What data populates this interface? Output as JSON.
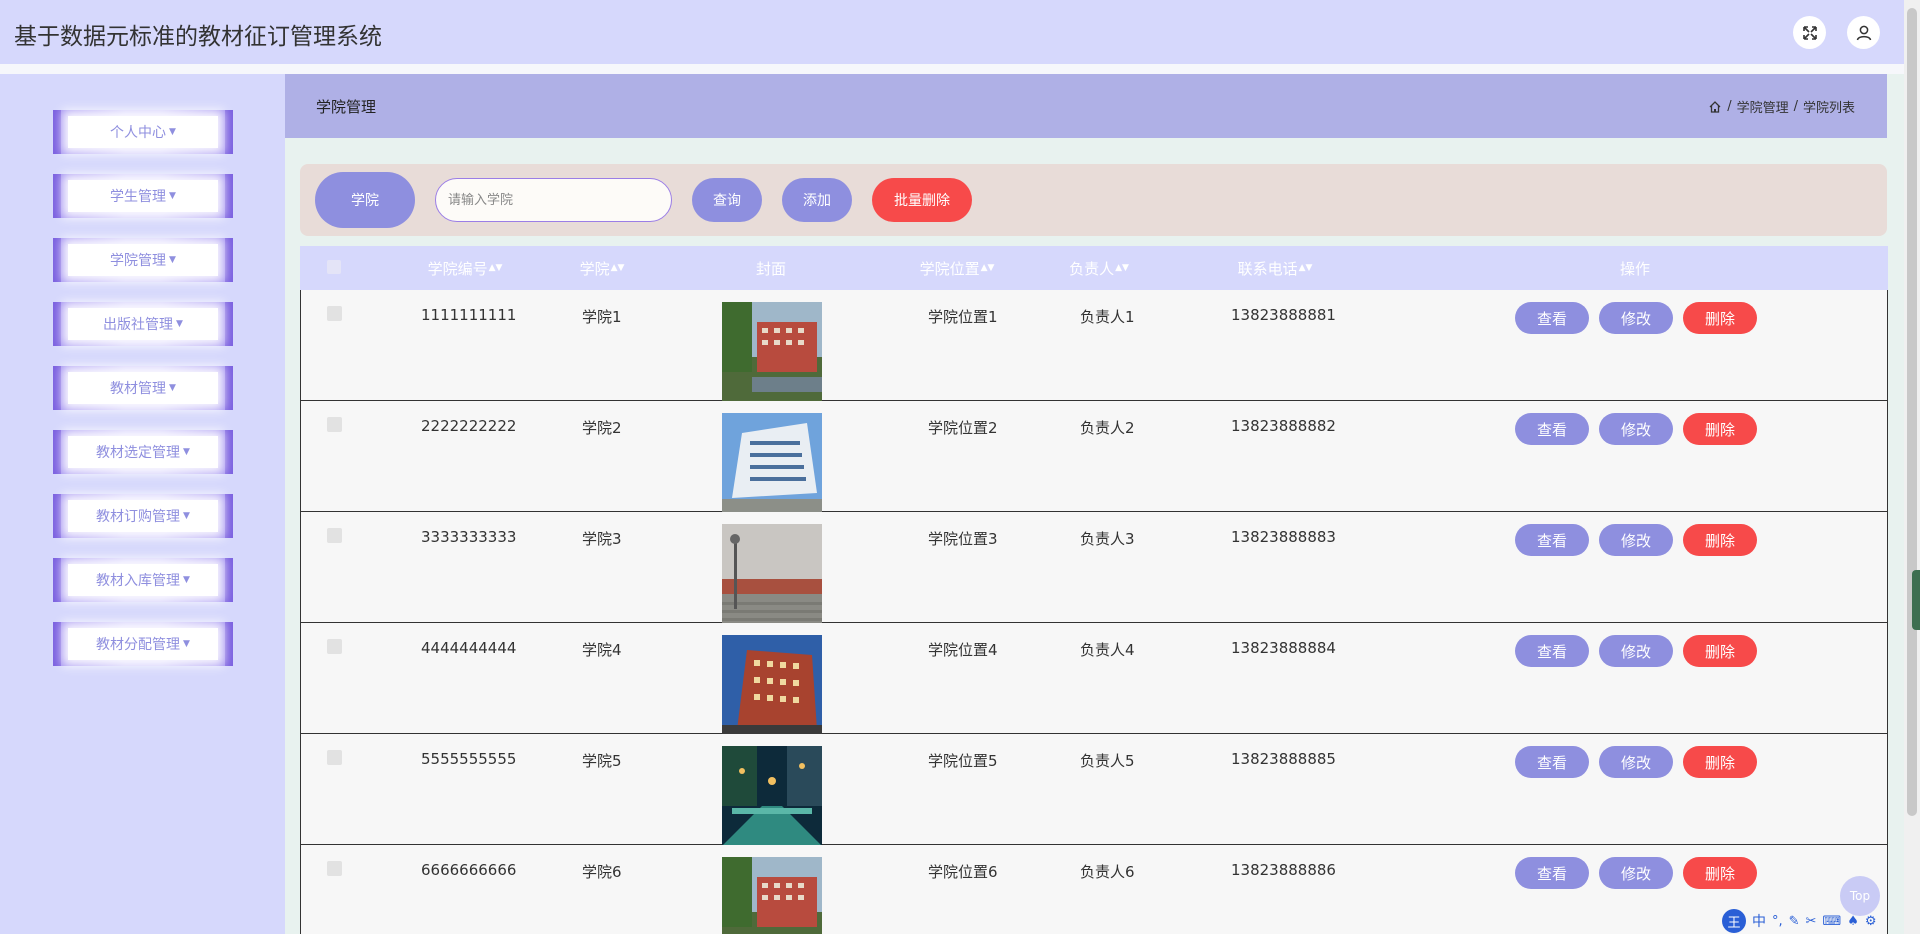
{
  "header": {
    "title": "基于数据元标准的教材征订管理系统",
    "fullscreen_icon": "expand-icon",
    "user_icon": "user-icon"
  },
  "sidebar": {
    "items": [
      {
        "label": "个人中心"
      },
      {
        "label": "学生管理"
      },
      {
        "label": "学院管理"
      },
      {
        "label": "出版社管理"
      },
      {
        "label": "教材管理"
      },
      {
        "label": "教材选定管理"
      },
      {
        "label": "教材订购管理"
      },
      {
        "label": "教材入库管理"
      },
      {
        "label": "教材分配管理"
      }
    ]
  },
  "page": {
    "title": "学院管理",
    "breadcrumb": [
      "学院管理",
      "学院列表"
    ]
  },
  "search": {
    "label": "学院",
    "placeholder": "请输入学院",
    "value": "",
    "query_label": "查询",
    "add_label": "添加",
    "batch_delete_label": "批量删除"
  },
  "table": {
    "headers": {
      "code": "学院编号",
      "name": "学院",
      "cover": "封面",
      "location": "学院位置",
      "manager": "负责人",
      "phone": "联系电话",
      "actions": "操作"
    },
    "sort_glyph": "◆",
    "action_labels": {
      "view": "查看",
      "edit": "修改",
      "delete": "删除"
    },
    "rows": [
      {
        "code": "1111111111",
        "name": "学院1",
        "location": "学院位置1",
        "manager": "负责人1",
        "phone": "13823888881"
      },
      {
        "code": "2222222222",
        "name": "学院2",
        "location": "学院位置2",
        "manager": "负责人2",
        "phone": "13823888882"
      },
      {
        "code": "3333333333",
        "name": "学院3",
        "location": "学院位置3",
        "manager": "负责人3",
        "phone": "13823888883"
      },
      {
        "code": "4444444444",
        "name": "学院4",
        "location": "学院位置4",
        "manager": "负责人4",
        "phone": "13823888884"
      },
      {
        "code": "5555555555",
        "name": "学院5",
        "location": "学院位置5",
        "manager": "负责人5",
        "phone": "13823888885"
      },
      {
        "code": "6666666666",
        "name": "学院6",
        "location": "学院位置6",
        "manager": "负责人6",
        "phone": "13823888886"
      }
    ]
  },
  "top_button": {
    "label": "Top"
  },
  "ime": {
    "logo": "王",
    "mode": "中"
  }
}
